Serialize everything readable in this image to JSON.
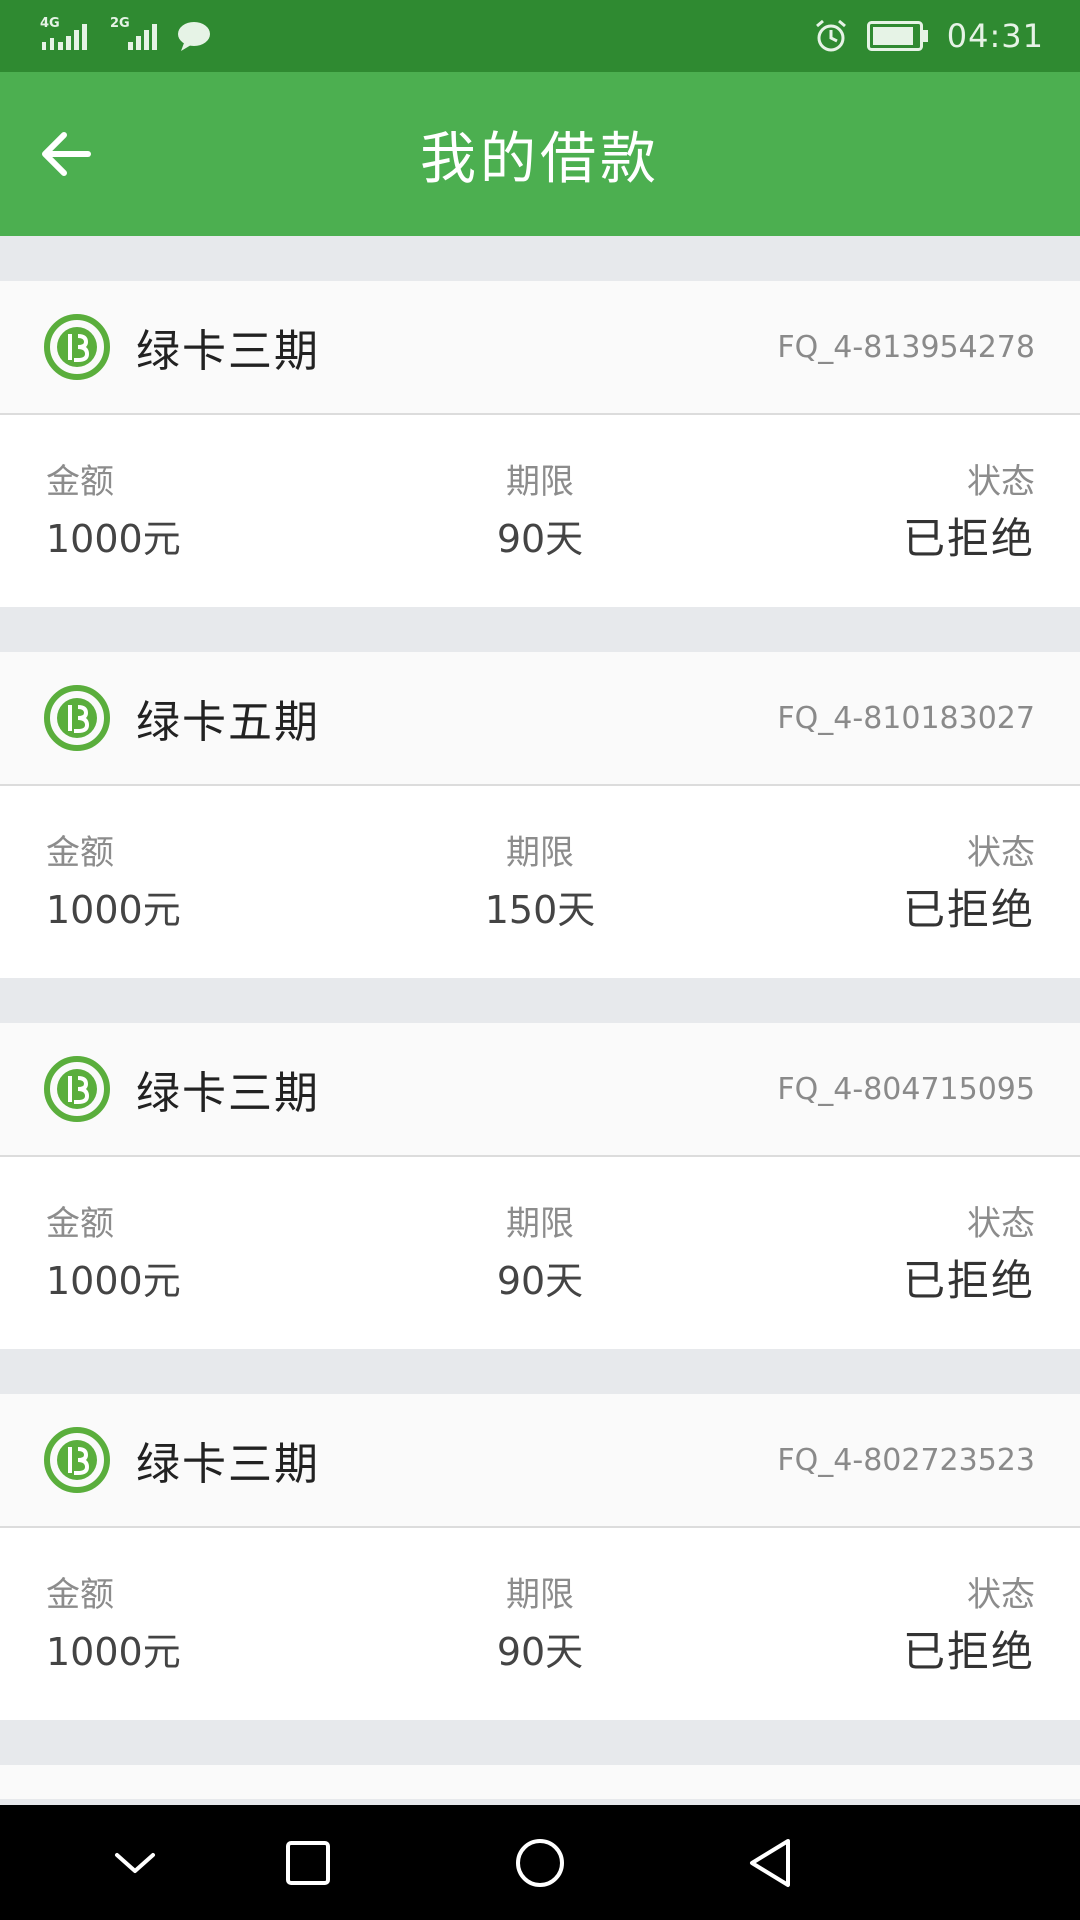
{
  "status_bar": {
    "network_1": "4G",
    "network_2": "2G",
    "time": "04:31",
    "icons": [
      "signal-4g-icon",
      "signal-2g-icon",
      "message-icon",
      "alarm-icon",
      "battery-icon"
    ]
  },
  "app_bar": {
    "title": "我的借款",
    "back_icon": "arrow-left-icon"
  },
  "labels": {
    "amount": "金额",
    "term": "期限",
    "status": "状态"
  },
  "loans": [
    {
      "product": "绿卡三期",
      "order_no": "FQ_4-813954278",
      "amount": "1000元",
      "term": "90天",
      "status": "已拒绝"
    },
    {
      "product": "绿卡五期",
      "order_no": "FQ_4-810183027",
      "amount": "1000元",
      "term": "150天",
      "status": "已拒绝"
    },
    {
      "product": "绿卡三期",
      "order_no": "FQ_4-804715095",
      "amount": "1000元",
      "term": "90天",
      "status": "已拒绝"
    },
    {
      "product": "绿卡三期",
      "order_no": "FQ_4-802723523",
      "amount": "1000元",
      "term": "90天",
      "status": "已拒绝"
    }
  ],
  "nav_bar": {
    "icons": [
      "collapse-icon",
      "recents-icon",
      "home-icon",
      "back-icon"
    ]
  },
  "colors": {
    "status_bar": "#2f8a31",
    "app_bar": "#4caf50",
    "logo": "#5aae3c",
    "background": "#e7e9ec"
  }
}
